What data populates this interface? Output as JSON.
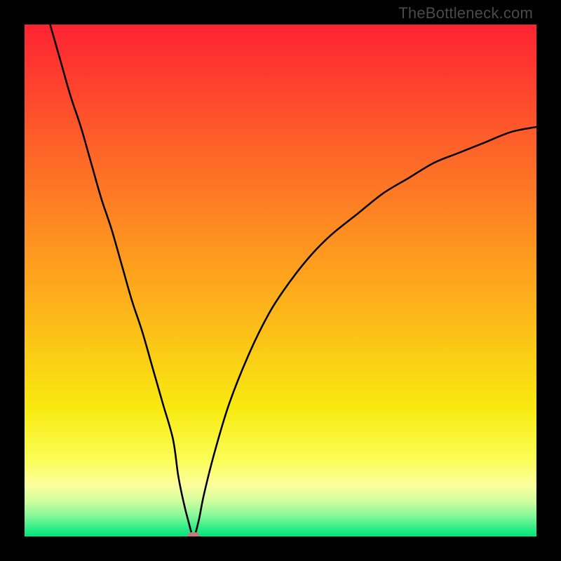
{
  "watermark": "TheBottleneck.com",
  "chart_data": {
    "type": "line",
    "title": "",
    "xlabel": "",
    "ylabel": "",
    "xlim": [
      0,
      100
    ],
    "ylim": [
      0,
      100
    ],
    "x": [
      5,
      7,
      9,
      11,
      13,
      15,
      17,
      19,
      21,
      23,
      25,
      27,
      29,
      30,
      31,
      32,
      33,
      34,
      35,
      37,
      40,
      44,
      48,
      52,
      56,
      60,
      65,
      70,
      75,
      80,
      85,
      90,
      95,
      100
    ],
    "y": [
      100,
      93,
      86,
      80,
      73,
      66,
      60,
      53,
      46,
      40,
      33,
      26,
      19,
      12,
      7,
      3,
      0,
      3,
      8,
      16,
      26,
      36,
      44,
      50,
      55,
      59,
      63,
      67,
      70,
      73,
      75,
      77,
      79,
      80
    ],
    "min_point": {
      "x": 33,
      "y": 0
    },
    "marker_color": "#c57c78",
    "curve_color": "#000000",
    "gradient_stops": [
      {
        "offset": 0.0,
        "color": "#fd2332"
      },
      {
        "offset": 0.15,
        "color": "#fe4a2c"
      },
      {
        "offset": 0.3,
        "color": "#fe7226"
      },
      {
        "offset": 0.45,
        "color": "#fe991f"
      },
      {
        "offset": 0.6,
        "color": "#fcc018"
      },
      {
        "offset": 0.75,
        "color": "#f8ea10"
      },
      {
        "offset": 0.85,
        "color": "#fbfd56"
      },
      {
        "offset": 0.9,
        "color": "#fcfe9f"
      },
      {
        "offset": 0.93,
        "color": "#d2fd9e"
      },
      {
        "offset": 0.96,
        "color": "#84f898"
      },
      {
        "offset": 0.985,
        "color": "#2bec86"
      },
      {
        "offset": 1.0,
        "color": "#00e67d"
      }
    ]
  }
}
